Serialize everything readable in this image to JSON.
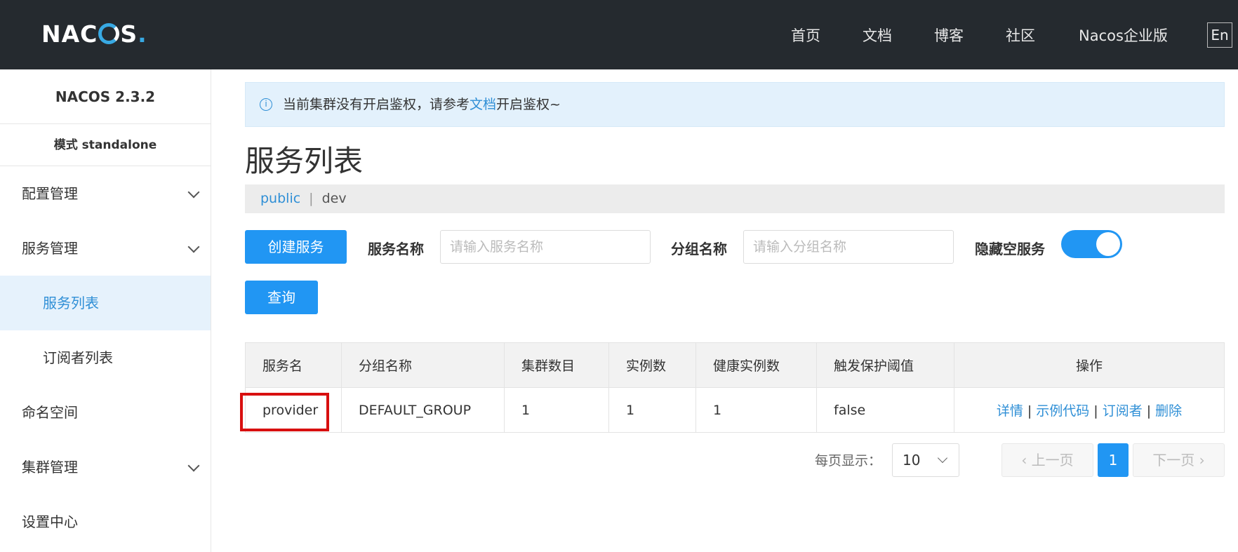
{
  "header": {
    "logo_text": "NACOS.",
    "nav": [
      "首页",
      "文档",
      "博客",
      "社区",
      "Nacos企业版"
    ],
    "lang_button": "En"
  },
  "sidebar": {
    "version": "NACOS 2.3.2",
    "mode": "模式 standalone",
    "items": [
      {
        "label": "配置管理",
        "expandable": true
      },
      {
        "label": "服务管理",
        "expandable": true
      },
      {
        "label": "服务列表",
        "sub": true,
        "active": true
      },
      {
        "label": "订阅者列表",
        "sub": true
      },
      {
        "label": "命名空间"
      },
      {
        "label": "集群管理",
        "expandable": true
      },
      {
        "label": "设置中心"
      }
    ]
  },
  "notice": {
    "text_before": "当前集群没有开启鉴权，请参考",
    "link": "文档",
    "text_after": "开启鉴权~"
  },
  "page_title": "服务列表",
  "namespaces": {
    "active": "public",
    "separator": "|",
    "other": "dev"
  },
  "toolbar": {
    "create_button": "创建服务",
    "service_name_label": "服务名称",
    "service_name_placeholder": "请输入服务名称",
    "group_name_label": "分组名称",
    "group_name_placeholder": "请输入分组名称",
    "hide_empty_label": "隐藏空服务",
    "hide_empty_on": true,
    "query_button": "查询"
  },
  "table": {
    "headers": [
      "服务名",
      "分组名称",
      "集群数目",
      "实例数",
      "健康实例数",
      "触发保护阈值",
      "操作"
    ],
    "rows": [
      {
        "name": "provider",
        "group": "DEFAULT_GROUP",
        "clusters": "1",
        "instances": "1",
        "healthy": "1",
        "threshold": "false",
        "actions": [
          "详情",
          "示例代码",
          "订阅者",
          "删除"
        ]
      }
    ]
  },
  "pagination": {
    "page_size_label": "每页显示：",
    "page_size": "10",
    "prev": "上一页",
    "current": "1",
    "next": "下一页"
  },
  "colors": {
    "accent": "#2196f3",
    "header_bg": "#252a2f",
    "highlight_box": "#d80f0f"
  }
}
